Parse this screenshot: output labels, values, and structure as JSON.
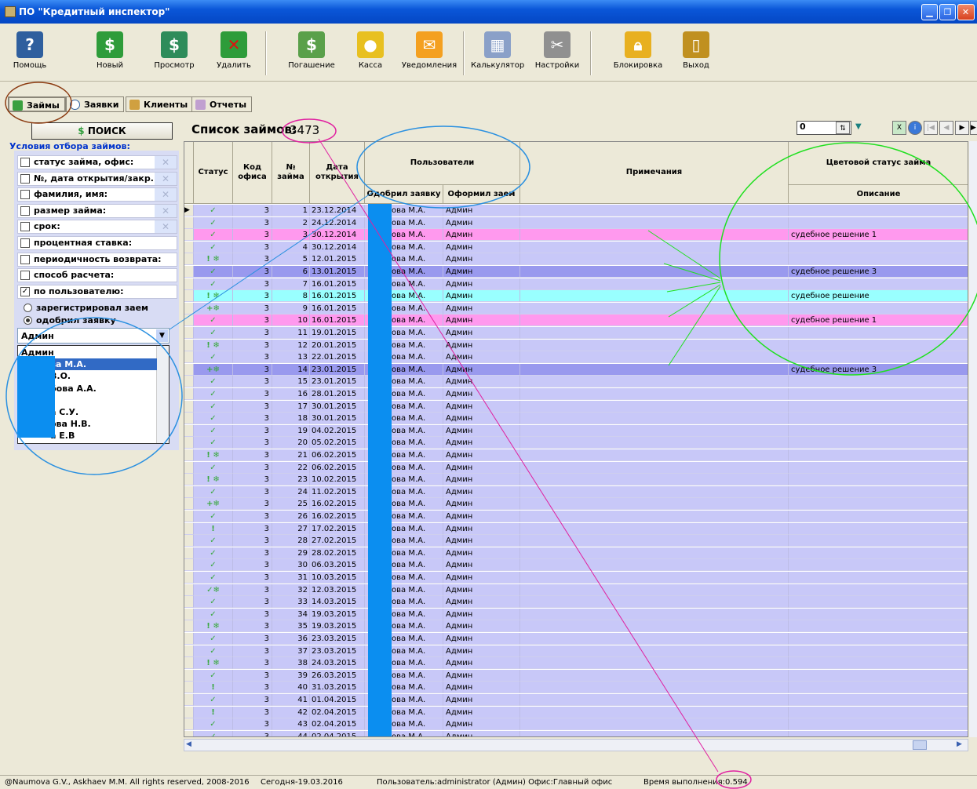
{
  "window": {
    "title": "ПО \"Кредитный инспектор\""
  },
  "toolbar": {
    "help": "Помощь",
    "new": "Новый",
    "view": "Просмотр",
    "delete": "Удалить",
    "repay": "Погашение",
    "cash": "Касса",
    "notify": "Уведомления",
    "calc": "Калькулятор",
    "settings": "Настройки",
    "lock": "Блокировка",
    "exit": "Выход"
  },
  "tabs": {
    "loans": "Займы",
    "requests": "Заявки",
    "clients": "Клиенты",
    "reports": "Отчеты"
  },
  "filter": {
    "search": "ПОИСК",
    "title": "Условия отбора займов:",
    "conditions": [
      {
        "label": "статус займа, офис:",
        "checked": false
      },
      {
        "label": "№, дата открытия/закр.:",
        "checked": false
      },
      {
        "label": "фамилия, имя:",
        "checked": false
      },
      {
        "label": "размер займа:",
        "checked": false
      },
      {
        "label": "срок:",
        "checked": false
      },
      {
        "label": "процентная ставка:",
        "checked": false
      },
      {
        "label": "периодичность возврата:",
        "checked": false
      },
      {
        "label": "способ расчета:",
        "checked": false
      },
      {
        "label": "по пользователю:",
        "checked": true
      }
    ],
    "radio_registered": "зарегистрировал заем",
    "radio_approved": "одобрил заявку",
    "user_value": "Админ",
    "users": [
      "Админ",
      "ва М.А.",
      "В.О.",
      "бова А.А.",
      "",
      "а С.У.",
      "ова Н.В.",
      "а Е.В"
    ]
  },
  "list": {
    "title": "Список займов:",
    "count": "3473",
    "page": "0"
  },
  "columns": {
    "status": "Статус",
    "office": "Код офиса",
    "number": "№ займа",
    "date": "Дата открытия",
    "users": "Пользователи",
    "approved": "Одобрил заявку",
    "issued": "Оформил заем",
    "notes": "Примечания",
    "color_status": "Цветовой статус займа",
    "description": "Описание"
  },
  "rows": [
    {
      "st": "✓",
      "o": "3",
      "n": "1",
      "d": "23.12.2014",
      "a": "ова М.А.",
      "i": "Админ",
      "desc": "",
      "bg": "#c8c8f8"
    },
    {
      "st": "✓",
      "o": "3",
      "n": "2",
      "d": "24.12.2014",
      "a": "ова М.А.",
      "i": "Админ",
      "desc": "",
      "bg": "#c8c8f8"
    },
    {
      "st": "✓",
      "o": "3",
      "n": "3",
      "d": "30.12.2014",
      "a": "ова М.А.",
      "i": "Админ",
      "desc": "судебное решение 1",
      "bg": "#ff99ee"
    },
    {
      "st": "✓",
      "o": "3",
      "n": "4",
      "d": "30.12.2014",
      "a": "ова М.А.",
      "i": "Админ",
      "desc": "",
      "bg": "#c8c8f8"
    },
    {
      "st": "! ❄",
      "o": "3",
      "n": "5",
      "d": "12.01.2015",
      "a": "ова М.А.",
      "i": "Админ",
      "desc": "",
      "bg": "#c8c8f8"
    },
    {
      "st": "✓",
      "o": "3",
      "n": "6",
      "d": "13.01.2015",
      "a": "ова М.А.",
      "i": "Админ",
      "desc": "судебное решение 3",
      "bg": "#9999ee"
    },
    {
      "st": "✓",
      "o": "3",
      "n": "7",
      "d": "16.01.2015",
      "a": "ова М.А.",
      "i": "Админ",
      "desc": "",
      "bg": "#c8c8f8"
    },
    {
      "st": "! ❄",
      "o": "3",
      "n": "8",
      "d": "16.01.2015",
      "a": "ова М.А.",
      "i": "Админ",
      "desc": "судебное решение",
      "bg": "#99ffff"
    },
    {
      "st": "+❄",
      "o": "3",
      "n": "9",
      "d": "16.01.2015",
      "a": "ова М.А.",
      "i": "Админ",
      "desc": "",
      "bg": "#c8c8f8"
    },
    {
      "st": "✓",
      "o": "3",
      "n": "10",
      "d": "16.01.2015",
      "a": "ова М.А.",
      "i": "Админ",
      "desc": "судебное решение 1",
      "bg": "#ff99ee"
    },
    {
      "st": "✓",
      "o": "3",
      "n": "11",
      "d": "19.01.2015",
      "a": "ова М.А.",
      "i": "Админ",
      "desc": "",
      "bg": "#c8c8f8"
    },
    {
      "st": "! ❄",
      "o": "3",
      "n": "12",
      "d": "20.01.2015",
      "a": "ова М.А.",
      "i": "Админ",
      "desc": "",
      "bg": "#c8c8f8"
    },
    {
      "st": "✓",
      "o": "3",
      "n": "13",
      "d": "22.01.2015",
      "a": "ова М.А.",
      "i": "Админ",
      "desc": "",
      "bg": "#c8c8f8"
    },
    {
      "st": "+❄",
      "o": "3",
      "n": "14",
      "d": "23.01.2015",
      "a": "ова М.А.",
      "i": "Админ",
      "desc": "судебное решение 3",
      "bg": "#9999ee"
    },
    {
      "st": "✓",
      "o": "3",
      "n": "15",
      "d": "23.01.2015",
      "a": "ова М.А.",
      "i": "Админ",
      "desc": "",
      "bg": "#c8c8f8"
    },
    {
      "st": "✓",
      "o": "3",
      "n": "16",
      "d": "28.01.2015",
      "a": "ова М.А.",
      "i": "Админ",
      "desc": "",
      "bg": "#c8c8f8"
    },
    {
      "st": "✓",
      "o": "3",
      "n": "17",
      "d": "30.01.2015",
      "a": "ова М.А.",
      "i": "Админ",
      "desc": "",
      "bg": "#c8c8f8"
    },
    {
      "st": "✓",
      "o": "3",
      "n": "18",
      "d": "30.01.2015",
      "a": "ова М.А.",
      "i": "Админ",
      "desc": "",
      "bg": "#c8c8f8"
    },
    {
      "st": "✓",
      "o": "3",
      "n": "19",
      "d": "04.02.2015",
      "a": "ова М.А.",
      "i": "Админ",
      "desc": "",
      "bg": "#c8c8f8"
    },
    {
      "st": "✓",
      "o": "3",
      "n": "20",
      "d": "05.02.2015",
      "a": "ова М.А.",
      "i": "Админ",
      "desc": "",
      "bg": "#c8c8f8"
    },
    {
      "st": "! ❄",
      "o": "3",
      "n": "21",
      "d": "06.02.2015",
      "a": "ова М.А.",
      "i": "Админ",
      "desc": "",
      "bg": "#c8c8f8"
    },
    {
      "st": "✓",
      "o": "3",
      "n": "22",
      "d": "06.02.2015",
      "a": "ова М.А.",
      "i": "Админ",
      "desc": "",
      "bg": "#c8c8f8"
    },
    {
      "st": "! ❄",
      "o": "3",
      "n": "23",
      "d": "10.02.2015",
      "a": "ова М.А.",
      "i": "Админ",
      "desc": "",
      "bg": "#c8c8f8"
    },
    {
      "st": "✓",
      "o": "3",
      "n": "24",
      "d": "11.02.2015",
      "a": "ова М.А.",
      "i": "Админ",
      "desc": "",
      "bg": "#c8c8f8"
    },
    {
      "st": "+❄",
      "o": "3",
      "n": "25",
      "d": "16.02.2015",
      "a": "ова М.А.",
      "i": "Админ",
      "desc": "",
      "bg": "#c8c8f8"
    },
    {
      "st": "✓",
      "o": "3",
      "n": "26",
      "d": "16.02.2015",
      "a": "ова М.А.",
      "i": "Админ",
      "desc": "",
      "bg": "#c8c8f8"
    },
    {
      "st": "!",
      "o": "3",
      "n": "27",
      "d": "17.02.2015",
      "a": "ова М.А.",
      "i": "Админ",
      "desc": "",
      "bg": "#c8c8f8"
    },
    {
      "st": "✓",
      "o": "3",
      "n": "28",
      "d": "27.02.2015",
      "a": "ова М.А.",
      "i": "Админ",
      "desc": "",
      "bg": "#c8c8f8"
    },
    {
      "st": "✓",
      "o": "3",
      "n": "29",
      "d": "28.02.2015",
      "a": "ова М.А.",
      "i": "Админ",
      "desc": "",
      "bg": "#c8c8f8"
    },
    {
      "st": "✓",
      "o": "3",
      "n": "30",
      "d": "06.03.2015",
      "a": "ова М.А.",
      "i": "Админ",
      "desc": "",
      "bg": "#c8c8f8"
    },
    {
      "st": "✓",
      "o": "3",
      "n": "31",
      "d": "10.03.2015",
      "a": "ова М.А.",
      "i": "Админ",
      "desc": "",
      "bg": "#c8c8f8"
    },
    {
      "st": "✓❄",
      "o": "3",
      "n": "32",
      "d": "12.03.2015",
      "a": "ова М.А.",
      "i": "Админ",
      "desc": "",
      "bg": "#c8c8f8"
    },
    {
      "st": "✓",
      "o": "3",
      "n": "33",
      "d": "14.03.2015",
      "a": "ова М.А.",
      "i": "Админ",
      "desc": "",
      "bg": "#c8c8f8"
    },
    {
      "st": "✓",
      "o": "3",
      "n": "34",
      "d": "19.03.2015",
      "a": "ова М.А.",
      "i": "Админ",
      "desc": "",
      "bg": "#c8c8f8"
    },
    {
      "st": "! ❄",
      "o": "3",
      "n": "35",
      "d": "19.03.2015",
      "a": "ова М.А.",
      "i": "Админ",
      "desc": "",
      "bg": "#c8c8f8"
    },
    {
      "st": "✓",
      "o": "3",
      "n": "36",
      "d": "23.03.2015",
      "a": "ова М.А.",
      "i": "Админ",
      "desc": "",
      "bg": "#c8c8f8"
    },
    {
      "st": "✓",
      "o": "3",
      "n": "37",
      "d": "23.03.2015",
      "a": "ова М.А.",
      "i": "Админ",
      "desc": "",
      "bg": "#c8c8f8"
    },
    {
      "st": "! ❄",
      "o": "3",
      "n": "38",
      "d": "24.03.2015",
      "a": "ова М.А.",
      "i": "Админ",
      "desc": "",
      "bg": "#c8c8f8"
    },
    {
      "st": "✓",
      "o": "3",
      "n": "39",
      "d": "26.03.2015",
      "a": "ова М.А.",
      "i": "Админ",
      "desc": "",
      "bg": "#c8c8f8"
    },
    {
      "st": "!",
      "o": "3",
      "n": "40",
      "d": "31.03.2015",
      "a": "ова М.А.",
      "i": "Админ",
      "desc": "",
      "bg": "#c8c8f8"
    },
    {
      "st": "✓",
      "o": "3",
      "n": "41",
      "d": "01.04.2015",
      "a": "ова М.А.",
      "i": "Админ",
      "desc": "",
      "bg": "#c8c8f8"
    },
    {
      "st": "!",
      "o": "3",
      "n": "42",
      "d": "02.04.2015",
      "a": "ова М.А.",
      "i": "Админ",
      "desc": "",
      "bg": "#c8c8f8"
    },
    {
      "st": "✓",
      "o": "3",
      "n": "43",
      "d": "02.04.2015",
      "a": "ова М.А.",
      "i": "Админ",
      "desc": "",
      "bg": "#c8c8f8"
    },
    {
      "st": "✓",
      "o": "3",
      "n": "44",
      "d": "02.04.2015",
      "a": "ова М.А.",
      "i": "Админ",
      "desc": "",
      "bg": "#c8c8f8"
    }
  ],
  "status": {
    "copyright": "@Naumova G.V., Askhaev M.M. All rights reserved, 2008-2016",
    "today": "Сегодня-19.03.2016",
    "user": "Пользователь:administrator (Админ) Офис:Главный офис",
    "time": "Время выполнения:0.594"
  }
}
